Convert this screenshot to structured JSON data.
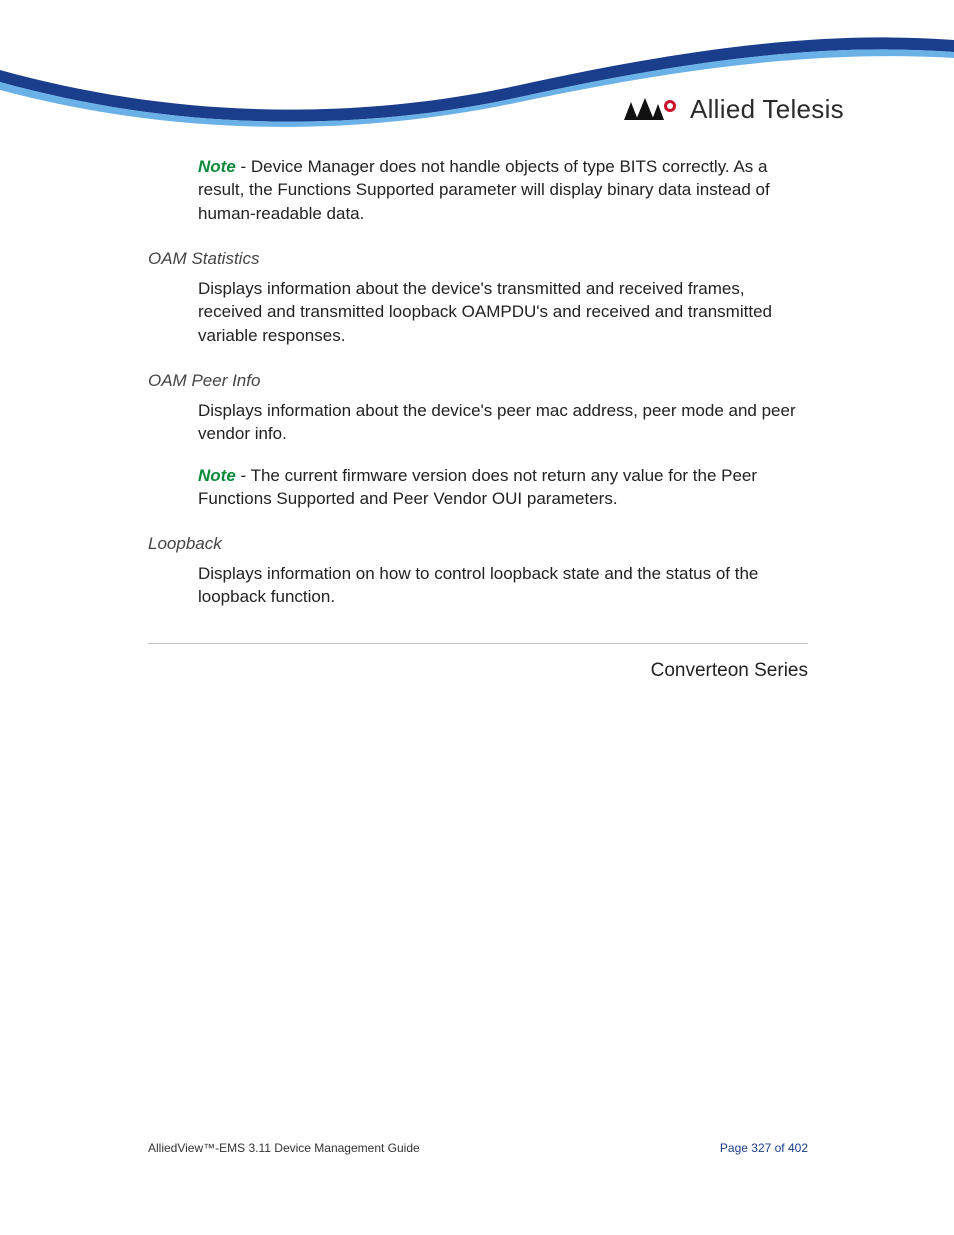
{
  "header": {
    "brand": "Allied Telesis"
  },
  "body": {
    "note1_label": "Note",
    "note1_text": " - Device Manager does not handle objects of type BITS correctly. As a result, the Functions Supported parameter will display binary data instead of human-readable data.",
    "sec1_label": "OAM Statistics",
    "sec1_text": "Displays information about the device's transmitted and received frames, received and transmitted loopback OAMPDU's and received and transmitted variable responses.",
    "sec2_label": "OAM Peer Info",
    "sec2_text": "Displays information about the device's peer mac address, peer mode and peer vendor info.",
    "note2_label": "Note",
    "note2_text": " - The current firmware version does not return any value for the Peer Functions Supported and Peer Vendor OUI parameters.",
    "sec3_label": "Loopback",
    "sec3_text": "Displays information on how to control loopback state and the status of the loopback function.",
    "section_title": "Converteon Series"
  },
  "footer": {
    "doc_title": "AlliedView™-EMS 3.11 Device Management Guide",
    "page_label": "Page 327 of 402"
  }
}
